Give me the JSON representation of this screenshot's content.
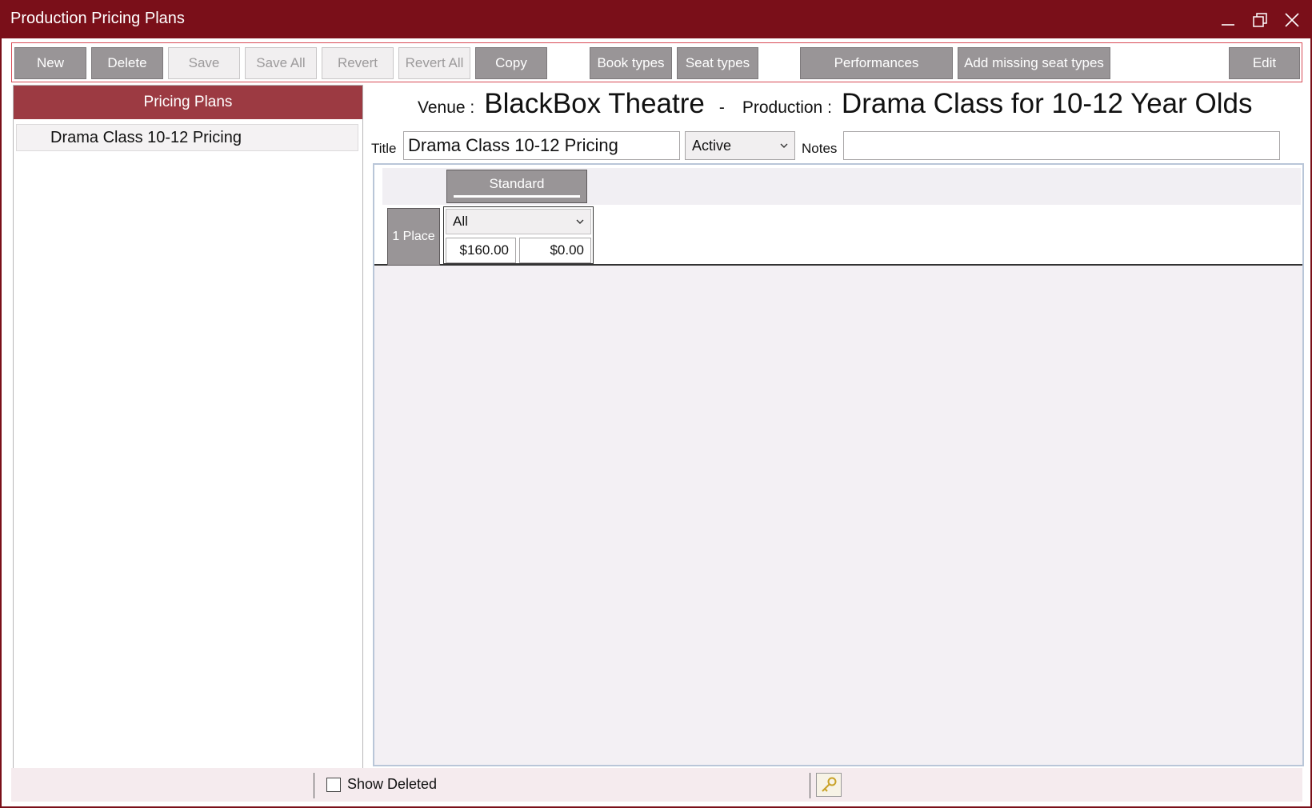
{
  "window": {
    "title": "Production Pricing Plans"
  },
  "toolbar": {
    "buttons": [
      {
        "label": "New",
        "enabled": true
      },
      {
        "label": "Delete",
        "enabled": true
      },
      {
        "label": "Save",
        "enabled": false
      },
      {
        "label": "Save All",
        "enabled": false
      },
      {
        "label": "Revert",
        "enabled": false
      },
      {
        "label": "Revert All",
        "enabled": false
      },
      {
        "label": "Copy",
        "enabled": true
      },
      {
        "label": "Book types",
        "enabled": true
      },
      {
        "label": "Seat types",
        "enabled": true
      },
      {
        "label": "Performances",
        "enabled": true
      },
      {
        "label": "Add missing seat types",
        "enabled": true
      },
      {
        "label": "Edit",
        "enabled": true
      }
    ]
  },
  "left_panel": {
    "header": "Pricing Plans",
    "items": [
      {
        "label": "Drama Class 10-12 Pricing"
      }
    ]
  },
  "details": {
    "venue_label": "Venue :",
    "venue": "BlackBox Theatre",
    "separator": "-",
    "production_label": "Production :",
    "production": "Drama Class for 10-12 Year Olds",
    "title_label": "Title",
    "title_value": "Drama Class 10-12 Pricing",
    "status": "Active",
    "notes_label": "Notes",
    "notes_value": ""
  },
  "grid": {
    "column_header": "Standard",
    "row_header": "1 Place",
    "cell": {
      "book_type": "All",
      "price": "$160.00",
      "fee": "$0.00"
    }
  },
  "statusbar": {
    "show_deleted_label": "Show Deleted",
    "show_deleted_checked": false
  },
  "colors": {
    "titlebar": "#7a0f19",
    "panel_header": "#9c3a42",
    "button": "#999597",
    "toolbar_border": "#d84a55"
  }
}
